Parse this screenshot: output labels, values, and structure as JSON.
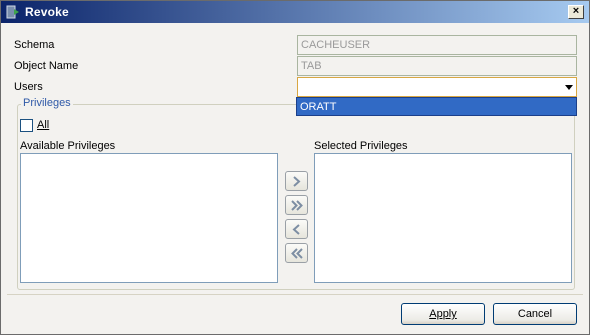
{
  "window": {
    "title": "Revoke",
    "close_glyph": "×"
  },
  "form": {
    "schema_label": "Schema",
    "schema_value": "CACHEUSER",
    "object_label": "Object Name",
    "object_value": "TAB",
    "users_label": "Users",
    "users_value": "",
    "users_options": [
      "ORATT"
    ]
  },
  "privileges": {
    "group_title": "Privileges",
    "all_label": "All",
    "all_checked": false,
    "available_label": "Available Privileges",
    "selected_label": "Selected Privileges",
    "available_items": [],
    "selected_items": []
  },
  "buttons": {
    "apply_label": "Apply",
    "cancel_label": "Cancel"
  },
  "icons": {
    "title": "database-shield-icon",
    "move_right": "chevron-right-icon",
    "move_all_right": "double-chevron-right-icon",
    "move_left": "chevron-left-icon",
    "move_all_left": "double-chevron-left-icon"
  }
}
